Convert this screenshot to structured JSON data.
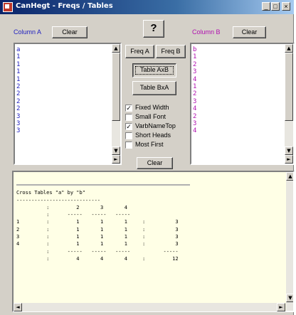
{
  "window": {
    "title": "CanHegt - Freqs / Tables",
    "minimize_glyph": "_",
    "maximize_glyph": "□",
    "close_glyph": "×"
  },
  "column_a": {
    "label": "Column A",
    "label_color": "#2020c0",
    "clear_label": "Clear",
    "values": [
      "a",
      "1",
      "1",
      "1",
      "1",
      "2",
      "2",
      "2",
      "2",
      "3",
      "3",
      "3"
    ],
    "value_color": "#2020c0"
  },
  "column_b": {
    "label": "Column B",
    "label_color": "#b010b0",
    "clear_label": "Clear",
    "values": [
      "b",
      "1",
      "2",
      "3",
      "4",
      "1",
      "2",
      "3",
      "4",
      "2",
      "3",
      "4"
    ],
    "value_color": "#b010b0"
  },
  "help_label": "?",
  "buttons": {
    "freq_a": "Freq A",
    "freq_b": "Freq B",
    "table_axb": "Table AxB",
    "table_bxa": "Table BxA",
    "clear": "Clear"
  },
  "options": [
    {
      "label": "Fixed Width",
      "checked": true
    },
    {
      "label": "Small Font",
      "checked": false
    },
    {
      "label": "VarbNameTop",
      "checked": true
    },
    {
      "label": "Short Heads",
      "checked": false
    },
    {
      "label": "Most First",
      "checked": false
    }
  ],
  "output": {
    "title": "Cross Tables \"a\" by \"b\"",
    "separator": "----------------------------",
    "header": "          :         2       3       4",
    "header_rule": "          :      -----   -----   -----",
    "rows": [
      "1         :         1       1       1     :          3",
      "2         :         1       1       1     :          3",
      "3         :         1       1       1     :          3",
      "4         :         1       1       1     :          3"
    ],
    "footer_rule": "          :      -----   -----   -----           -----",
    "totals": "          :         4       4       4     :         12"
  },
  "icons": {
    "check": "✓",
    "arrow_up": "▲",
    "arrow_down": "▼",
    "arrow_left": "◄",
    "arrow_right": "►"
  }
}
